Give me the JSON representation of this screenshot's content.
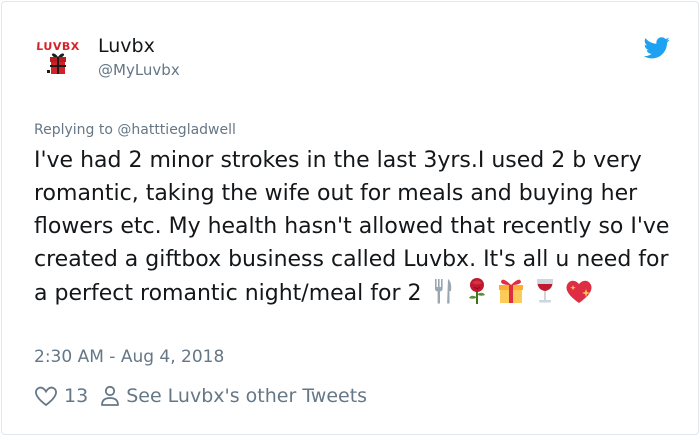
{
  "author": {
    "avatar_text": "LUVBX",
    "name": "Luvbx",
    "handle": "@MyLuvbx",
    "icon": "twitter-bird-icon"
  },
  "reply": {
    "text": "Replying to @hatttiegladwell"
  },
  "tweet": {
    "text": "I've had 2 minor strokes in the last 3yrs.I used 2 b very romantic, taking the wife out for meals and buying her flowers etc. My health hasn't allowed that recently so I've created a giftbox business called Luvbx. It's all u need for a perfect romantic night/meal for 2",
    "emojis": [
      "fork-knife-icon",
      "rose-icon",
      "gift-icon",
      "wine-glass-icon",
      "sparkling-heart-icon"
    ]
  },
  "timestamp": "2:30 AM - Aug 4, 2018",
  "actions": {
    "like_count": "13",
    "other_tweets_label": "See Luvbx's other Tweets"
  },
  "colors": {
    "text": "#14171a",
    "secondary": "#657786",
    "twitter_blue": "#1da1f2",
    "border": "#e1e8ed",
    "brand_red": "#d32027"
  }
}
